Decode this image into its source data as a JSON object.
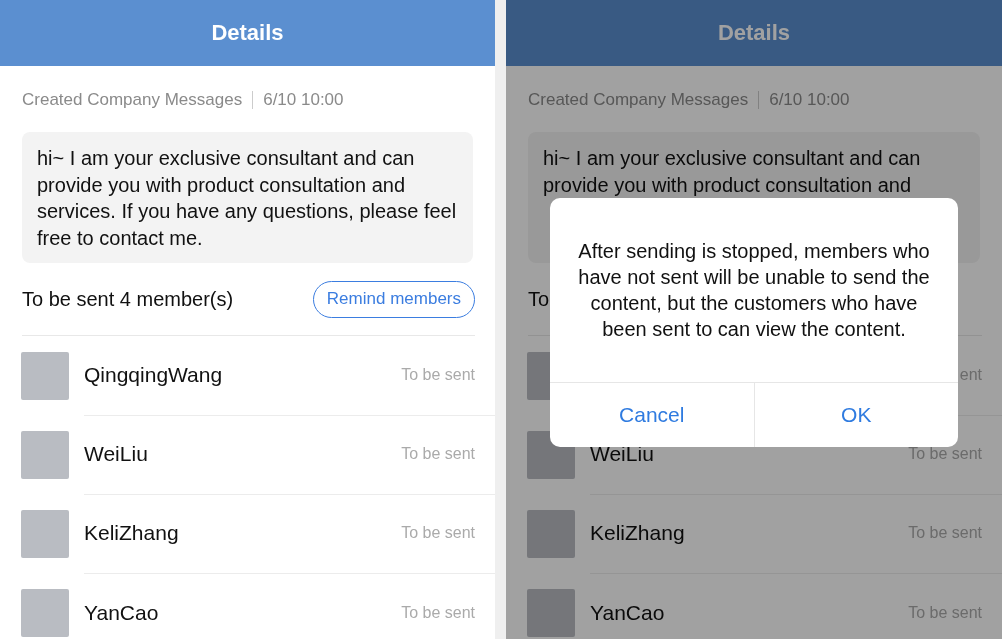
{
  "screens": [
    {
      "header": {
        "title": "Details"
      },
      "meta": {
        "source": "Created Company Messages",
        "time": "6/10 10:00"
      },
      "message": "hi~ I am your exclusive consultant and can provide you with product consultation and services.  If you have any questions, please feel free to contact me.",
      "section": {
        "title": "To be sent 4 member(s)",
        "button": "Remind members"
      },
      "members": [
        {
          "name": "QingqingWang",
          "status": "To be sent"
        },
        {
          "name": "WeiLiu",
          "status": "To be sent"
        },
        {
          "name": "KeliZhang",
          "status": "To be sent"
        },
        {
          "name": "YanCao",
          "status": "To be sent"
        }
      ]
    },
    {
      "header": {
        "title": "Details"
      },
      "meta": {
        "source": "Created Company Messages",
        "time": "6/10 10:00"
      },
      "message": "hi~ I am your exclusive consultant and can provide you with product consultation and",
      "section": {
        "title": "To"
      },
      "members": [
        {
          "status": "ent"
        },
        {
          "name": "WeiLiu",
          "status": "To be sent"
        },
        {
          "name": "KeliZhang",
          "status": "To be sent"
        },
        {
          "name": "YanCao",
          "status": "To be sent"
        }
      ],
      "dialog": {
        "text": "After sending is stopped, members who have not sent will be unable to send the content, but the customers who have been sent to can view the content.",
        "buttons": [
          "Cancel",
          "OK"
        ]
      }
    }
  ]
}
